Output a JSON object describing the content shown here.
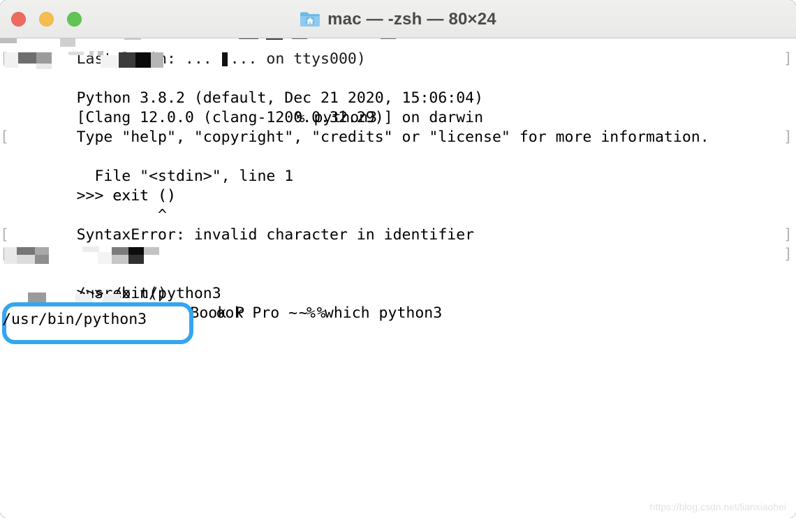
{
  "window": {
    "title": "mac — -zsh — 80×24",
    "icon": "home-folder-icon",
    "traffic_lights": [
      {
        "name": "close",
        "color": "#ec6a5e"
      },
      {
        "name": "minimize",
        "color": "#f5bd4f"
      },
      {
        "name": "maximize",
        "color": "#61c454"
      }
    ]
  },
  "terminal": {
    "prompt_bracket_left": "[",
    "prompt_bracket_right": "]",
    "cursor": "block",
    "lines": [
      {
        "id": "l0",
        "text": "Last login: ...  ... on ttys000)",
        "redacted": true,
        "prompt": false,
        "clipped": true
      },
      {
        "id": "l1",
        "text": "% python3",
        "redacted": true,
        "prompt": true,
        "indent": 320
      },
      {
        "id": "l2",
        "text": "Python 3.8.2 (default, Dec 21 2020, 15:06:04)",
        "redacted": false,
        "prompt": false
      },
      {
        "id": "l3",
        "text": "[Clang 12.0.0 (clang-1200.0.32.29)] on darwin",
        "redacted": false,
        "prompt": false
      },
      {
        "id": "l4",
        "text": "Type \"help\", \"copyright\", \"credits\" or \"license\" for more information.",
        "redacted": false,
        "prompt": false
      },
      {
        "id": "l5",
        "text": ">>> exit ()",
        "redacted": false,
        "prompt": true
      },
      {
        "id": "l6",
        "text": "  File \"<stdin>\", line 1",
        "redacted": false,
        "prompt": false
      },
      {
        "id": "l7",
        "text": "    exit ()",
        "redacted": false,
        "prompt": false
      },
      {
        "id": "l8",
        "text": "         ^",
        "redacted": false,
        "prompt": false
      },
      {
        "id": "l9",
        "text": "SyntaxError: invalid character in identifier",
        "redacted": false,
        "prompt": false
      },
      {
        "id": "l10",
        "text": ">>> exit()",
        "redacted": false,
        "prompt": true
      },
      {
        "id": "l11",
        "text": "ook Pro ~ % which python3",
        "redacted": true,
        "prompt": true,
        "indent": 245
      },
      {
        "id": "l12",
        "text": "/usr/bin/python3",
        "redacted": false,
        "prompt": false
      },
      {
        "id": "l13",
        "text": "MacBook P      ~ % ",
        "redacted": true,
        "prompt": false,
        "indent": 130,
        "cursor": true
      }
    ]
  },
  "annotation": {
    "highlight_text": "/usr/bin/python3",
    "highlight_color": "#36a5ef"
  },
  "watermark": {
    "text": "https://blog.csdn.net/lianxiaohei"
  }
}
